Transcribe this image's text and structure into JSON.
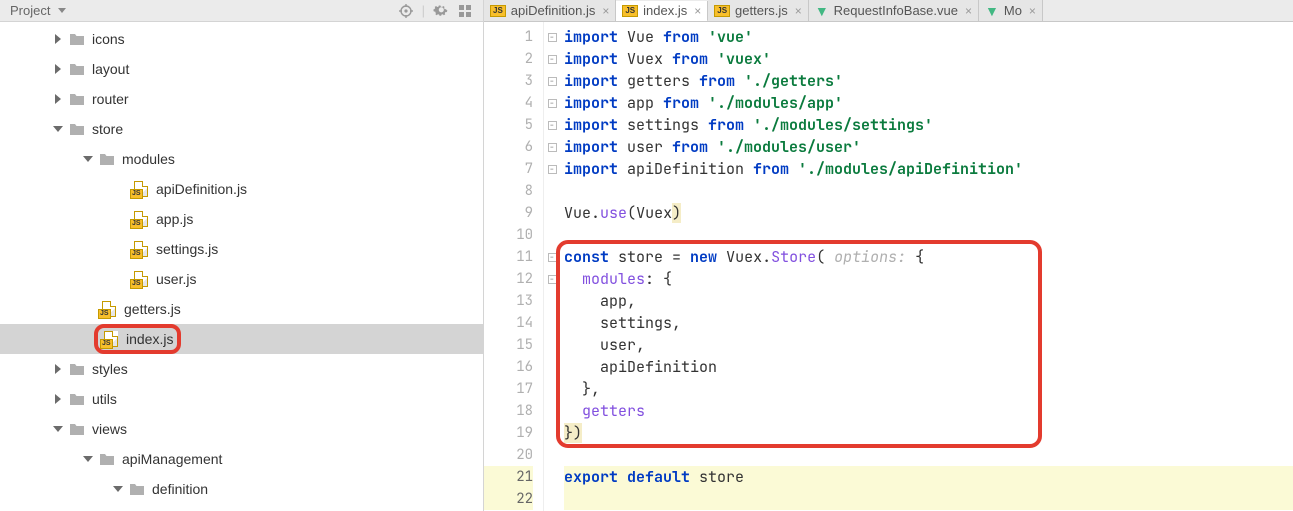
{
  "sidebar": {
    "title": "Project",
    "tree": [
      {
        "indent": 50,
        "arrow": "right",
        "type": "folder",
        "label": "icons"
      },
      {
        "indent": 50,
        "arrow": "right",
        "type": "folder",
        "label": "layout"
      },
      {
        "indent": 50,
        "arrow": "right",
        "type": "folder",
        "label": "router"
      },
      {
        "indent": 50,
        "arrow": "down",
        "type": "folder",
        "label": "store"
      },
      {
        "indent": 80,
        "arrow": "down",
        "type": "folder",
        "label": "modules"
      },
      {
        "indent": 132,
        "arrow": "",
        "type": "js",
        "label": "apiDefinition.js"
      },
      {
        "indent": 132,
        "arrow": "",
        "type": "js",
        "label": "app.js"
      },
      {
        "indent": 132,
        "arrow": "",
        "type": "js",
        "label": "settings.js"
      },
      {
        "indent": 132,
        "arrow": "",
        "type": "js",
        "label": "user.js"
      },
      {
        "indent": 100,
        "arrow": "",
        "type": "js",
        "label": "getters.js"
      },
      {
        "indent": 100,
        "arrow": "",
        "type": "js",
        "label": "index.js",
        "selected": true,
        "ring": true
      },
      {
        "indent": 50,
        "arrow": "right",
        "type": "folder",
        "label": "styles"
      },
      {
        "indent": 50,
        "arrow": "right",
        "type": "folder",
        "label": "utils"
      },
      {
        "indent": 50,
        "arrow": "down",
        "type": "folder",
        "label": "views"
      },
      {
        "indent": 80,
        "arrow": "down",
        "type": "folder",
        "label": "apiManagement"
      },
      {
        "indent": 110,
        "arrow": "down",
        "type": "folder",
        "label": "definition"
      }
    ]
  },
  "tabs": [
    {
      "icon": "js",
      "label": "apiDefinition.js"
    },
    {
      "icon": "js",
      "label": "index.js",
      "active": true
    },
    {
      "icon": "js",
      "label": "getters.js"
    },
    {
      "icon": "vue",
      "label": "RequestInfoBase.vue"
    },
    {
      "icon": "vue",
      "label": "Mo"
    }
  ],
  "code": {
    "lines": [
      [
        {
          "t": "import ",
          "c": "kw"
        },
        {
          "t": "Vue ",
          "c": "id"
        },
        {
          "t": "from ",
          "c": "kw"
        },
        {
          "t": "'vue'",
          "c": "str"
        }
      ],
      [
        {
          "t": "import ",
          "c": "kw"
        },
        {
          "t": "Vuex ",
          "c": "id"
        },
        {
          "t": "from ",
          "c": "kw"
        },
        {
          "t": "'vuex'",
          "c": "str"
        }
      ],
      [
        {
          "t": "import ",
          "c": "kw"
        },
        {
          "t": "getters ",
          "c": "id"
        },
        {
          "t": "from ",
          "c": "kw"
        },
        {
          "t": "'./getters'",
          "c": "str"
        }
      ],
      [
        {
          "t": "import ",
          "c": "kw"
        },
        {
          "t": "app ",
          "c": "id"
        },
        {
          "t": "from ",
          "c": "kw"
        },
        {
          "t": "'./modules/app'",
          "c": "str"
        }
      ],
      [
        {
          "t": "import ",
          "c": "kw"
        },
        {
          "t": "settings ",
          "c": "id"
        },
        {
          "t": "from ",
          "c": "kw"
        },
        {
          "t": "'./modules/settings'",
          "c": "str"
        }
      ],
      [
        {
          "t": "import ",
          "c": "kw"
        },
        {
          "t": "user ",
          "c": "id"
        },
        {
          "t": "from ",
          "c": "kw"
        },
        {
          "t": "'./modules/user'",
          "c": "str"
        }
      ],
      [
        {
          "t": "import ",
          "c": "kw"
        },
        {
          "t": "apiDefinition ",
          "c": "id"
        },
        {
          "t": "from ",
          "c": "kw"
        },
        {
          "t": "'./modules/apiDefinition'",
          "c": "str"
        }
      ],
      [
        {
          "t": "",
          "c": ""
        }
      ],
      [
        {
          "t": "Vue",
          "c": "id"
        },
        {
          "t": ".",
          "c": "pu"
        },
        {
          "t": "use",
          "c": "fn"
        },
        {
          "t": "(",
          "c": "pu"
        },
        {
          "t": "Vuex",
          "c": "id"
        },
        {
          "t": ")",
          "c": "pu hl-gold"
        }
      ],
      [
        {
          "t": "",
          "c": ""
        }
      ],
      [
        {
          "t": "const ",
          "c": "kw"
        },
        {
          "t": "store ",
          "c": "id"
        },
        {
          "t": "= ",
          "c": "pu"
        },
        {
          "t": "new ",
          "c": "kw"
        },
        {
          "t": "Vuex",
          "c": "id"
        },
        {
          "t": ".",
          "c": "pu"
        },
        {
          "t": "Store",
          "c": "fn"
        },
        {
          "t": "(",
          "c": "pu"
        },
        {
          "t": " options: ",
          "c": "hint"
        },
        {
          "t": "{",
          "c": "pu"
        }
      ],
      [
        {
          "t": "  modules",
          "c": "fn"
        },
        {
          "t": ": {",
          "c": "pu"
        }
      ],
      [
        {
          "t": "    app",
          "c": "id"
        },
        {
          "t": ",",
          "c": "pu"
        }
      ],
      [
        {
          "t": "    settings",
          "c": "id"
        },
        {
          "t": ",",
          "c": "pu"
        }
      ],
      [
        {
          "t": "    user",
          "c": "id"
        },
        {
          "t": ",",
          "c": "pu"
        }
      ],
      [
        {
          "t": "    apiDefinition",
          "c": "id"
        }
      ],
      [
        {
          "t": "  },",
          "c": "pu"
        }
      ],
      [
        {
          "t": "  getters",
          "c": "fn"
        }
      ],
      [
        {
          "t": "})",
          "c": "pu hl-gold"
        }
      ],
      [
        {
          "t": "",
          "c": ""
        }
      ],
      [
        {
          "t": "export default ",
          "c": "kw"
        },
        {
          "t": "store",
          "c": "id"
        }
      ],
      [
        {
          "t": "",
          "c": ""
        }
      ]
    ],
    "sel_rows": [
      21,
      22
    ],
    "fold_minus": [
      1,
      2,
      3,
      4,
      5,
      6,
      7,
      11,
      12
    ],
    "red_box": {
      "top_line": 11,
      "bottom_line": 19
    }
  }
}
